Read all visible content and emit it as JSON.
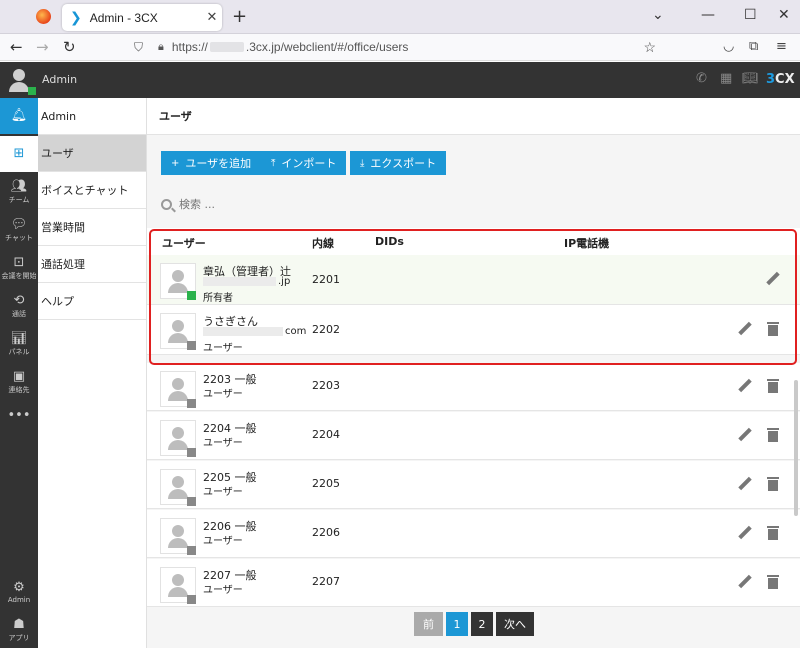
{
  "browser": {
    "tab_title": "Admin - 3CX",
    "tab_close": "✕",
    "new_tab": "+",
    "url_prefix": "https://",
    "url_rest": ".3cx.jp/webclient/#/office/users",
    "window_controls": [
      "—",
      "☐",
      "✕"
    ]
  },
  "header": {
    "username": "Admin",
    "brand_prefix": "3",
    "brand_suffix": "CX"
  },
  "rail": {
    "items": [
      {
        "label": "",
        "icon": "bell-icon"
      },
      {
        "label": "",
        "icon": "windows-icon"
      },
      {
        "label": "チーム",
        "icon": "team-icon"
      },
      {
        "label": "チャット",
        "icon": "chat-icon"
      },
      {
        "label": "会議を開始",
        "icon": "meeting-icon"
      },
      {
        "label": "通話",
        "icon": "history-icon"
      },
      {
        "label": "パネル",
        "icon": "panel-icon"
      },
      {
        "label": "連絡先",
        "icon": "contacts-icon"
      },
      {
        "label": "",
        "icon": "more-icon"
      }
    ],
    "bottom": [
      {
        "label": "Admin",
        "icon": "gear-icon"
      },
      {
        "label": "アプリ",
        "icon": "apps-icon"
      }
    ]
  },
  "menu": {
    "items": [
      "Admin",
      "ユーザ",
      "ボイスとチャット",
      "営業時間",
      "通話処理",
      "ヘルプ"
    ]
  },
  "page": {
    "title": "ユーザ",
    "buttons": {
      "add": "ユーザを追加",
      "import": "インポート",
      "export": "エクスポート"
    },
    "search_placeholder": "検索 ..."
  },
  "table": {
    "headers": {
      "user": "ユーザー",
      "ext": "内線",
      "dids": "DIDs",
      "ip_phone": "IP電話機"
    },
    "rows": [
      {
        "name": "章弘（管理者）辻",
        "email_suffix": ".jp",
        "role": "所有者",
        "ext": "2201",
        "status": "green"
      },
      {
        "name": "うさぎさん",
        "email_suffix": "com",
        "role": "ユーザー",
        "ext": "2202",
        "status": "gray"
      },
      {
        "name": "2203 一般",
        "email_suffix": "",
        "role": "ユーザー",
        "ext": "2203",
        "status": "gray"
      },
      {
        "name": "2204 一般",
        "email_suffix": "",
        "role": "ユーザー",
        "ext": "2204",
        "status": "gray"
      },
      {
        "name": "2205 一般",
        "email_suffix": "",
        "role": "ユーザー",
        "ext": "2205",
        "status": "gray"
      },
      {
        "name": "2206 一般",
        "email_suffix": "",
        "role": "ユーザー",
        "ext": "2206",
        "status": "gray"
      },
      {
        "name": "2207 一般",
        "email_suffix": "",
        "role": "ユーザー",
        "ext": "2207",
        "status": "gray"
      }
    ]
  },
  "pager": {
    "prev": "前",
    "p1": "1",
    "p2": "2",
    "next": "次へ"
  },
  "colors": {
    "accent": "#1c97d5",
    "dark": "#333333",
    "online": "#2bb24c",
    "highlight": "#e02020"
  }
}
